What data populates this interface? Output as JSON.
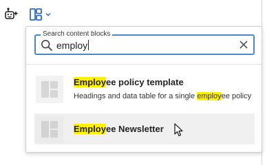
{
  "toolbar": {
    "ai_icon": "ai-assistant-icon",
    "blocks_icon": "insert-block-icon",
    "dropdown_icon": "chevron-down-icon"
  },
  "search": {
    "legend": "Search content blocks",
    "value": "employ",
    "placeholder": "",
    "search_icon": "search-icon",
    "clear_icon": "close-icon"
  },
  "results": [
    {
      "title_match": "Employ",
      "title_rest": "ee policy template",
      "desc_before": "Headings and data table for a single ",
      "desc_match": "employ",
      "desc_after": "ee policy",
      "thumbnail_icon": "block-thumbnail-icon"
    },
    {
      "title_match": "Employ",
      "title_rest": "ee Newsletter",
      "thumbnail_icon": "block-thumbnail-icon"
    }
  ],
  "colors": {
    "highlight": "#fff200",
    "focus_border": "#4a86c8",
    "hover_row": "#f0f0f0"
  }
}
